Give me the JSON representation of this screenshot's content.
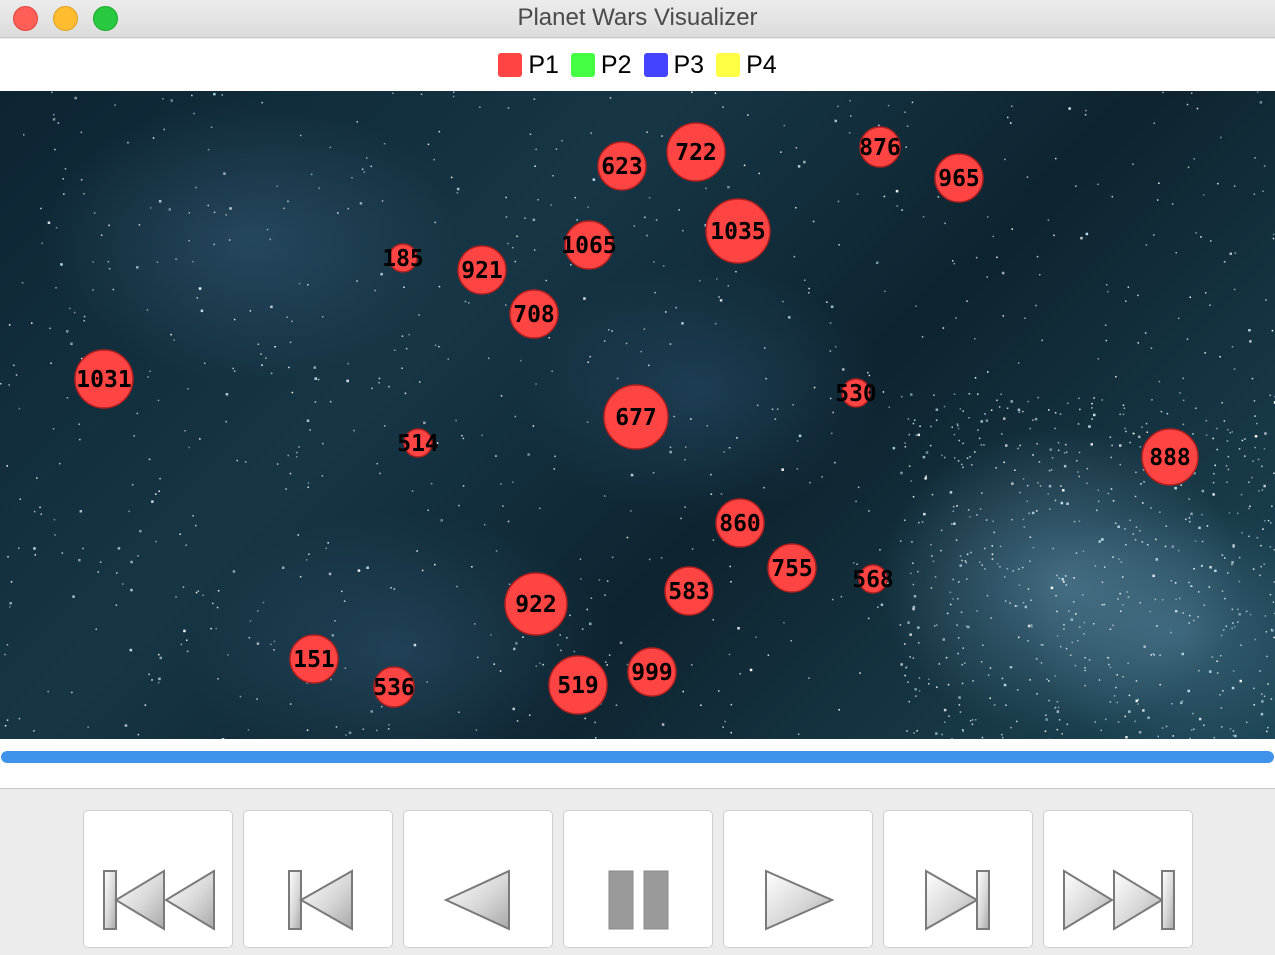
{
  "window": {
    "title": "Planet Wars Visualizer"
  },
  "legend": [
    {
      "label": "P1",
      "color": "#ff4444"
    },
    {
      "label": "P2",
      "color": "#44ff44"
    },
    {
      "label": "P3",
      "color": "#4444ff"
    },
    {
      "label": "P4",
      "color": "#ffff44"
    }
  ],
  "planet_color": "#ff4444",
  "planets": [
    {
      "ships": "722"
    },
    {
      "ships": "623"
    },
    {
      "ships": "876"
    },
    {
      "ships": "965"
    },
    {
      "ships": "1035"
    },
    {
      "ships": "1065"
    },
    {
      "ships": "185"
    },
    {
      "ships": "921"
    },
    {
      "ships": "708"
    },
    {
      "ships": "1031"
    },
    {
      "ships": "530"
    },
    {
      "ships": "677"
    },
    {
      "ships": "514"
    },
    {
      "ships": "888"
    },
    {
      "ships": "860"
    },
    {
      "ships": "755"
    },
    {
      "ships": "568"
    },
    {
      "ships": "583"
    },
    {
      "ships": "922"
    },
    {
      "ships": "151"
    },
    {
      "ships": "999"
    },
    {
      "ships": "536"
    },
    {
      "ships": "519"
    }
  ],
  "progress": {
    "fraction": 1.0,
    "color": "#3f93ea"
  },
  "controls": [
    {
      "icon": "rewind-to-start-icon"
    },
    {
      "icon": "step-to-start-icon"
    },
    {
      "icon": "play-backward-icon"
    },
    {
      "icon": "pause-icon"
    },
    {
      "icon": "play-forward-icon"
    },
    {
      "icon": "step-to-end-icon"
    },
    {
      "icon": "fast-forward-to-end-icon"
    }
  ]
}
